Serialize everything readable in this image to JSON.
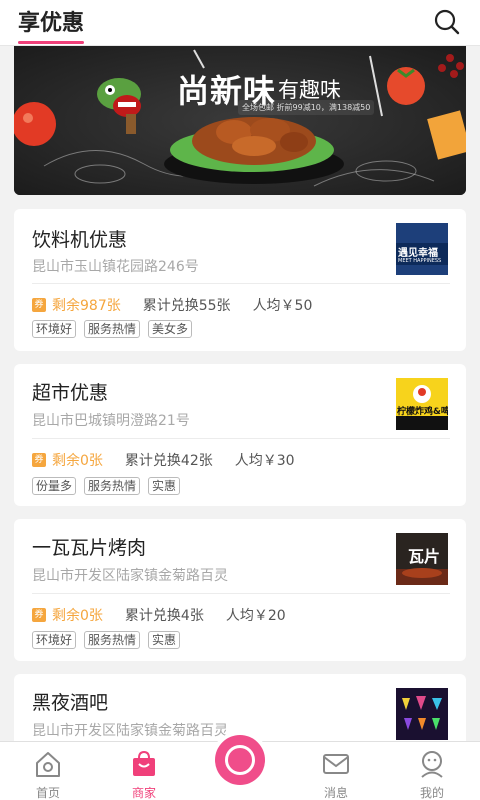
{
  "header": {
    "title": "享优惠",
    "search_icon": "search-icon"
  },
  "banner": {
    "slogan_big": "尚新味",
    "slogan_small": "有趣味",
    "promo_text": "全场包邮 折前99减10，满138减50"
  },
  "labels": {
    "coupon": "券"
  },
  "shops": [
    {
      "name": "饮料机优惠",
      "address": "昆山市玉山镇花园路246号",
      "remaining": "剩余987张",
      "redeemed": "累计兑换55张",
      "avg_price": "人均￥50",
      "tags": [
        "环境好",
        "服务热情",
        "美女多"
      ],
      "thumb_text": "遇见幸福",
      "thumb_sub": "MEET HAPPINESS"
    },
    {
      "name": "超市优惠",
      "address": "昆山市巴城镇明澄路21号",
      "remaining": "剩余0张",
      "redeemed": "累计兑换42张",
      "avg_price": "人均￥30",
      "tags": [
        "份量多",
        "服务热情",
        "实惠"
      ],
      "thumb_text": "柠檬炸鸡&啤",
      "thumb_sub": ""
    },
    {
      "name": "一瓦瓦片烤肉",
      "address": "昆山市开发区陆家镇金菊路百灵",
      "remaining": "剩余0张",
      "redeemed": "累计兑换4张",
      "avg_price": "人均￥20",
      "tags": [
        "环境好",
        "服务热情",
        "实惠"
      ],
      "thumb_text": "瓦片",
      "thumb_sub": ""
    },
    {
      "name": "黑夜酒吧",
      "address": "昆山市开发区陆家镇金菊路百灵",
      "thumb_text": "",
      "thumb_sub": ""
    }
  ],
  "tabbar": {
    "items": [
      {
        "label": "首页",
        "icon": "home-icon"
      },
      {
        "label": "商家",
        "icon": "shopping-bag-icon"
      },
      {
        "label": "",
        "icon": "camera-button-icon"
      },
      {
        "label": "消息",
        "icon": "mail-icon"
      },
      {
        "label": "我的",
        "icon": "profile-icon"
      }
    ],
    "active_index": 1
  },
  "colors": {
    "accent": "#f0407a",
    "coupon": "#f5a63e",
    "background": "#f2f2f2"
  }
}
